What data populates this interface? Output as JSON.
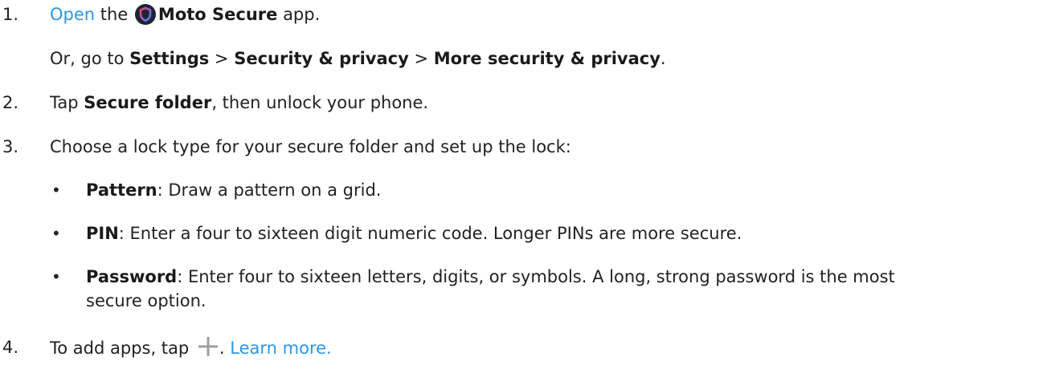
{
  "steps": [
    {
      "number": "1.",
      "link_text": "Open",
      "text_the": " the ",
      "app_name": "Moto Secure",
      "text_app": " app.",
      "alt_prefix": "Or, go to ",
      "alt_settings": "Settings",
      "sep1": " > ",
      "alt_security": "Security & privacy",
      "sep2": " > ",
      "alt_more": "More security & privacy",
      "alt_end": "."
    },
    {
      "number": "2.",
      "text_pre": "Tap ",
      "bold": "Secure folder",
      "text_post": ", then unlock your phone."
    },
    {
      "number": "3.",
      "text": "Choose a lock type for your secure folder and set up the lock:"
    },
    {
      "number": "4.",
      "text_pre": "To add apps, tap ",
      "text_period": ". ",
      "link_text": "Learn more."
    }
  ],
  "lock_types": [
    {
      "name": "Pattern",
      "desc": ": Draw a pattern on a grid."
    },
    {
      "name": "PIN",
      "desc": ": Enter a four to sixteen digit numeric code. Longer PINs are more secure."
    },
    {
      "name": "Password",
      "desc": ": Enter four to sixteen letters, digits, or symbols. A long, strong password is the most",
      "desc_cont": "secure option."
    }
  ],
  "bullet": "•",
  "icons": {
    "app": "moto-secure-shield-icon",
    "add": "plus-icon"
  },
  "colors": {
    "link": "#2a97e8",
    "text": "#212121",
    "app_icon_bg": "#1c2433"
  }
}
